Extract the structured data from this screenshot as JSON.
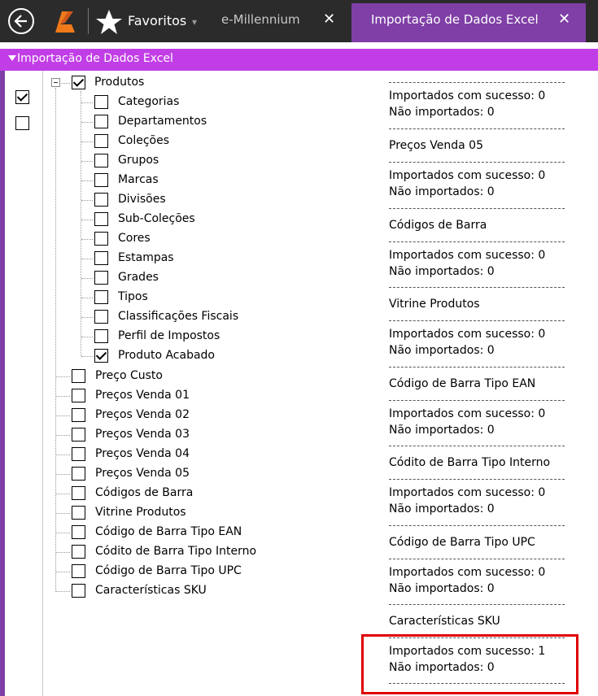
{
  "topbar": {
    "favorites_label": "Favoritos",
    "favorites_caret": "▾",
    "tabs": [
      {
        "label": "e-Millennium",
        "close": "✕"
      },
      {
        "label": "Importação de Dados Excel",
        "close": "✕"
      }
    ]
  },
  "section": {
    "title": "Importação de Dados Excel"
  },
  "colors": {
    "accent": "#7f3fa6",
    "section": "#c13ee6",
    "highlight": "#e00000"
  },
  "tree": {
    "root": {
      "label": "Produtos",
      "checked": true
    },
    "children": [
      {
        "label": "Categorias",
        "checked": false
      },
      {
        "label": "Departamentos",
        "checked": false
      },
      {
        "label": "Coleções",
        "checked": false
      },
      {
        "label": "Grupos",
        "checked": false
      },
      {
        "label": "Marcas",
        "checked": false
      },
      {
        "label": "Divisões",
        "checked": false
      },
      {
        "label": "Sub-Coleções",
        "checked": false
      },
      {
        "label": "Cores",
        "checked": false
      },
      {
        "label": "Estampas",
        "checked": false
      },
      {
        "label": "Grades",
        "checked": false
      },
      {
        "label": "Tipos",
        "checked": false
      },
      {
        "label": "Classificações Fiscais",
        "checked": false
      },
      {
        "label": "Perfil de Impostos",
        "checked": false
      },
      {
        "label": "Produto Acabado",
        "checked": true
      }
    ],
    "siblings": [
      {
        "label": "Preço Custo",
        "checked": false
      },
      {
        "label": "Preços Venda 01",
        "checked": false
      },
      {
        "label": "Preços Venda 02",
        "checked": false
      },
      {
        "label": "Preços Venda 03",
        "checked": false
      },
      {
        "label": "Preços Venda 04",
        "checked": false
      },
      {
        "label": "Preços Venda 05",
        "checked": false
      },
      {
        "label": "Códigos de Barra",
        "checked": false
      },
      {
        "label": "Vitrine Produtos",
        "checked": false
      },
      {
        "label": "Código de Barra Tipo EAN",
        "checked": false
      },
      {
        "label": "Códito de Barra Tipo Interno",
        "checked": false
      },
      {
        "label": "Código de Barra Tipo UPC",
        "checked": false
      },
      {
        "label": "Características SKU",
        "checked": false
      }
    ]
  },
  "side_checks": [
    {
      "checked": true
    },
    {
      "checked": false
    }
  ],
  "log": {
    "dash": "-----------------------------------",
    "success_label": "Importados com sucesso: 0",
    "fail_label": "Não importados: 0",
    "entries": [
      "Preços Venda 05",
      "Códigos de Barra",
      "Vitrine Produtos",
      "Código de Barra Tipo EAN",
      "Códito de Barra Tipo Interno",
      "Código de Barra Tipo UPC",
      "Características SKU"
    ],
    "final_success": "Importados com sucesso: 1",
    "final_fail": "Não importados: 0"
  }
}
